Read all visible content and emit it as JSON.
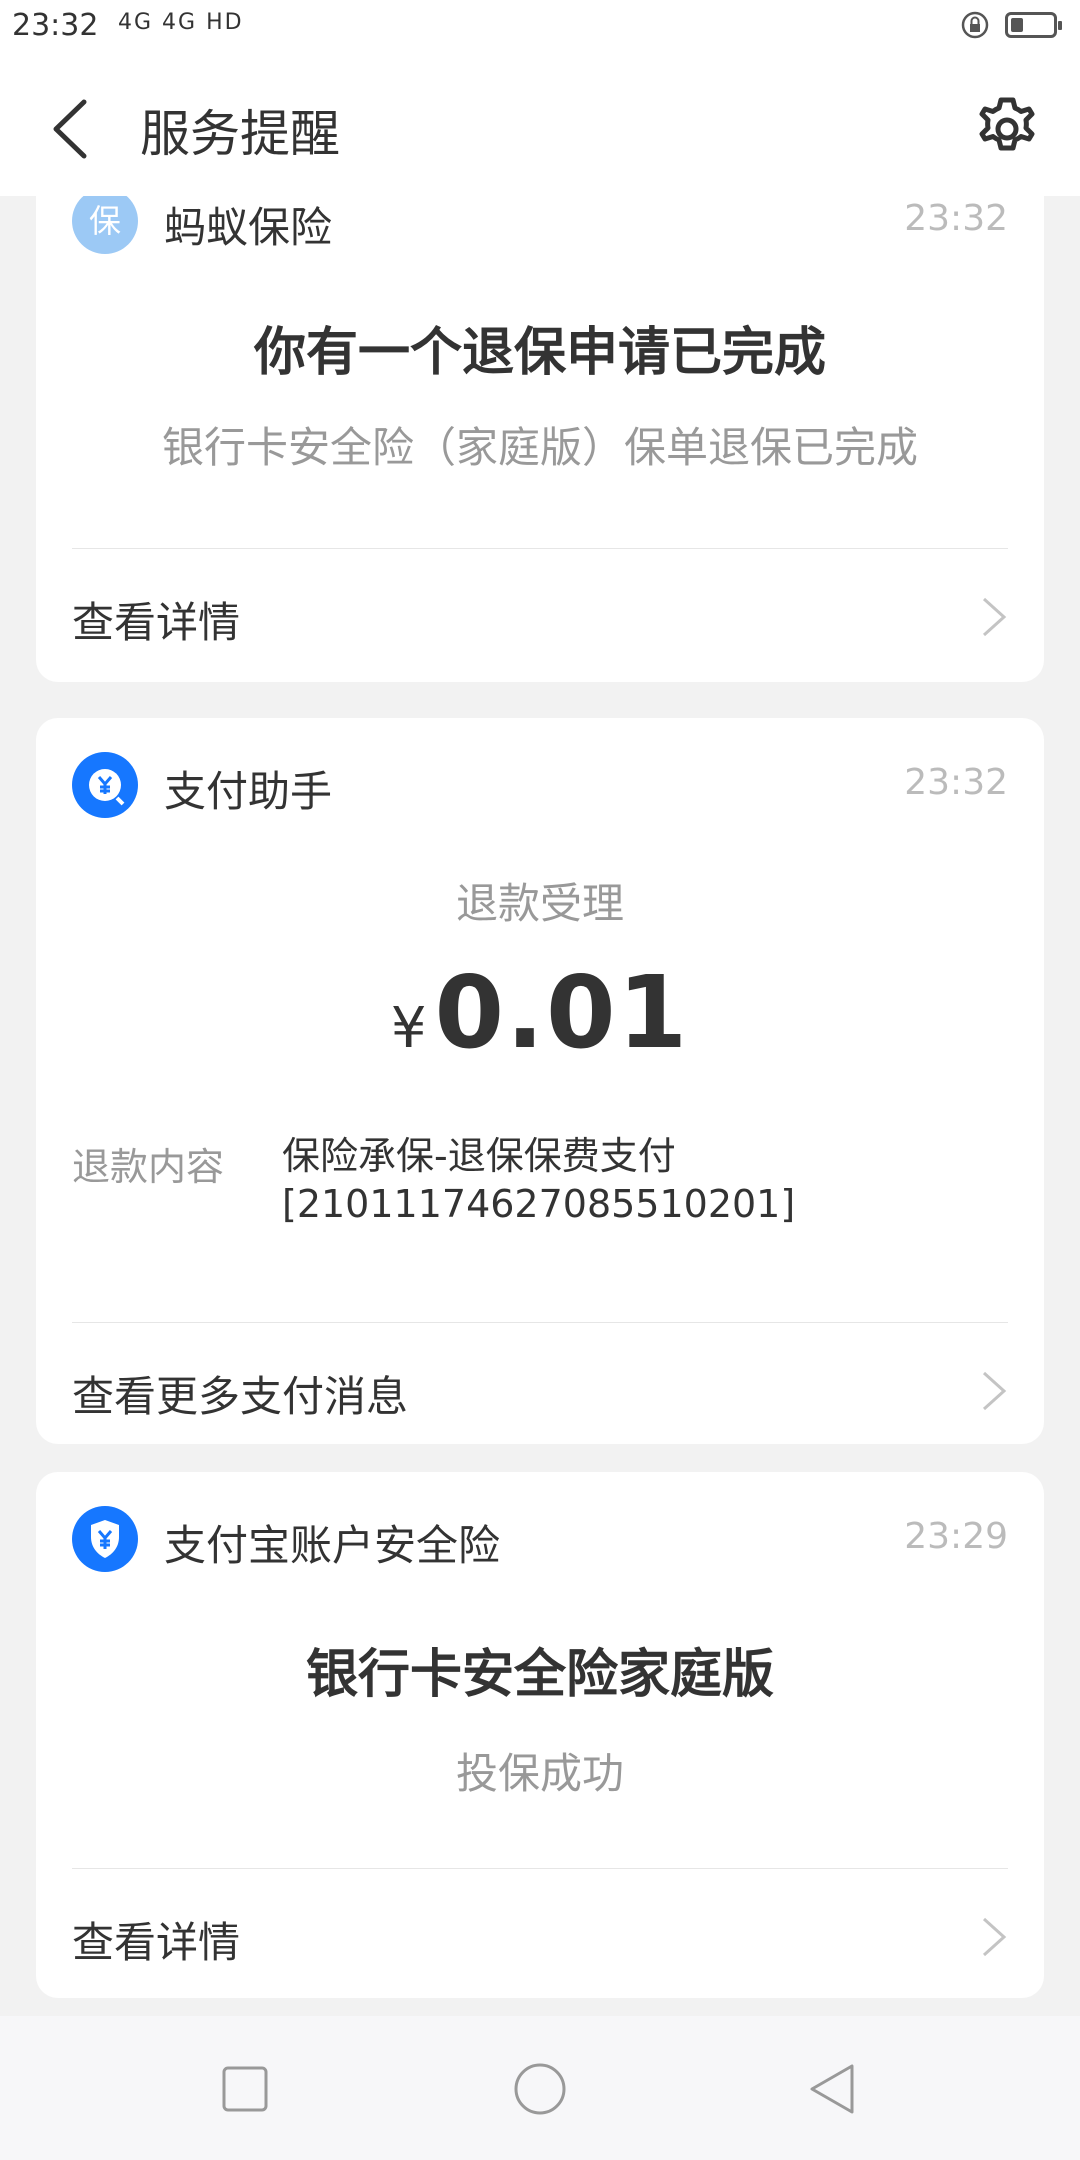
{
  "status_bar": {
    "time": "23:32",
    "signal_text": "4G 4G HD"
  },
  "nav": {
    "title": "服务提醒"
  },
  "cards": [
    {
      "sender": "蚂蚁保险",
      "icon": "shield-bao-icon",
      "icon_glyph": "保",
      "icon_color": "#9cc9f5",
      "time": "23:32",
      "headline": "你有一个退保申请已完成",
      "subline": "银行卡安全险（家庭版）保单退保已完成",
      "link_label": "查看详情"
    },
    {
      "sender": "支付助手",
      "icon": "yuan-coin-icon",
      "icon_glyph": "¥",
      "icon_color": "#1677ff",
      "time": "23:32",
      "subtitle": "退款受理",
      "currency": "¥",
      "amount": "0.01",
      "detail_label": "退款内容",
      "detail_value_line1": "保险承保-退保保费支付",
      "detail_value_line2": "[2101117462708551020​1]",
      "link_label": "查看更多支付消息"
    },
    {
      "sender": "支付宝账户安全险",
      "icon": "shield-yuan-icon",
      "icon_glyph": "¥",
      "icon_color": "#1677ff",
      "time": "23:29",
      "headline": "银行卡安全险家庭版",
      "subline": "投保成功",
      "link_label": "查看详情"
    }
  ],
  "colors": {
    "accent": "#1677ff",
    "text_primary": "#333333",
    "text_secondary": "#999999",
    "background": "#f2f2f2"
  },
  "battery_level": 0.3
}
